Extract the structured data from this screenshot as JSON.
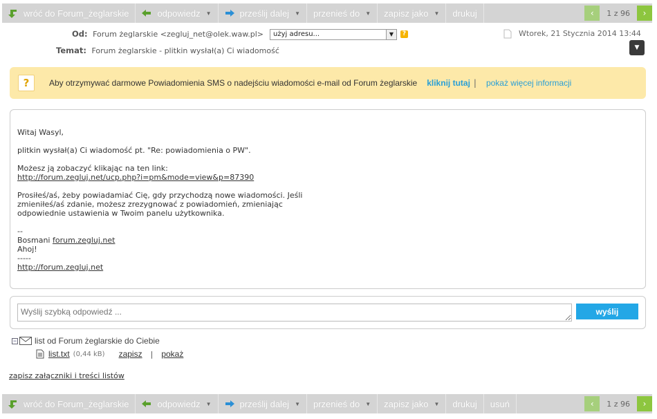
{
  "toolbar_top": {
    "back": "wróć do Forum_żeglarskie",
    "reply": "odpowiedz",
    "forward": "prześlij dalej",
    "move": "przenieś do",
    "save_as": "zapisz jako",
    "print": "drukuj",
    "pager": "1 z 96",
    "prev": "‹",
    "next": "›"
  },
  "toolbar_bottom": {
    "back": "wróć do Forum_żeglarskie",
    "reply": "odpowiedz",
    "forward": "prześlij dalej",
    "move": "przenieś do",
    "save_as": "zapisz jako",
    "print": "drukuj",
    "delete": "usuń",
    "pager": "1 z 96",
    "prev": "‹",
    "next": "›"
  },
  "header": {
    "from_label": "Od:",
    "from_value": "Forum żeglarskie <zegluj_net@olek.waw.pl>",
    "address_select": "użyj adresu...",
    "date": "Wtorek, 21 Stycznia 2014 13:44",
    "subject_label": "Temat:",
    "subject_value": "Forum żeglarskie - plitkin wysłał(a) Ci wiadomość"
  },
  "sms_banner": {
    "text": "Aby otrzymywać darmowe Powiadomienia SMS o nadejściu wiadomości e-mail od Forum żeglarskie",
    "link1": "kliknij tutaj",
    "separator": "|",
    "link2": "pokaż więcej informacji"
  },
  "message": {
    "greeting": "Witaj Wasyl,",
    "line1": "plitkin wysłał(a) Ci wiadomość pt. \"Re: powiadomienia o PW\".",
    "line2": "Możesz ją zobaczyć klikając na ten link:",
    "link": "http://forum.zegluj.net/ucp.php?i=pm&mode=view&p=87390",
    "para3": "Prosiłeś/aś, żeby powiadamiać Cię, gdy przychodzą nowe wiadomości. Jeśli\nzmieniłeś/aś zdanie, możesz zrezygnować z powiadomień, zmieniając\nodpowiednie ustawienia w Twoim panelu użytkownika.",
    "sig_dash": "--",
    "sig_prefix": "Bosmani ",
    "sig_link": "forum.zegluj.net",
    "ahoj": "Ahoj!",
    "dashes": "-----",
    "footer_link": "http://forum.zegluj.net"
  },
  "reply": {
    "placeholder": "Wyślij szybką odpowiedź ...",
    "send": "wyślij"
  },
  "attachments": {
    "header": "list od Forum żeglarskie do Ciebie",
    "file_name": "list.txt",
    "file_size": "(0,44 kB)",
    "save": "zapisz",
    "sep": "|",
    "show": "pokaż",
    "save_all": "zapisz załączniki i treści listów"
  }
}
